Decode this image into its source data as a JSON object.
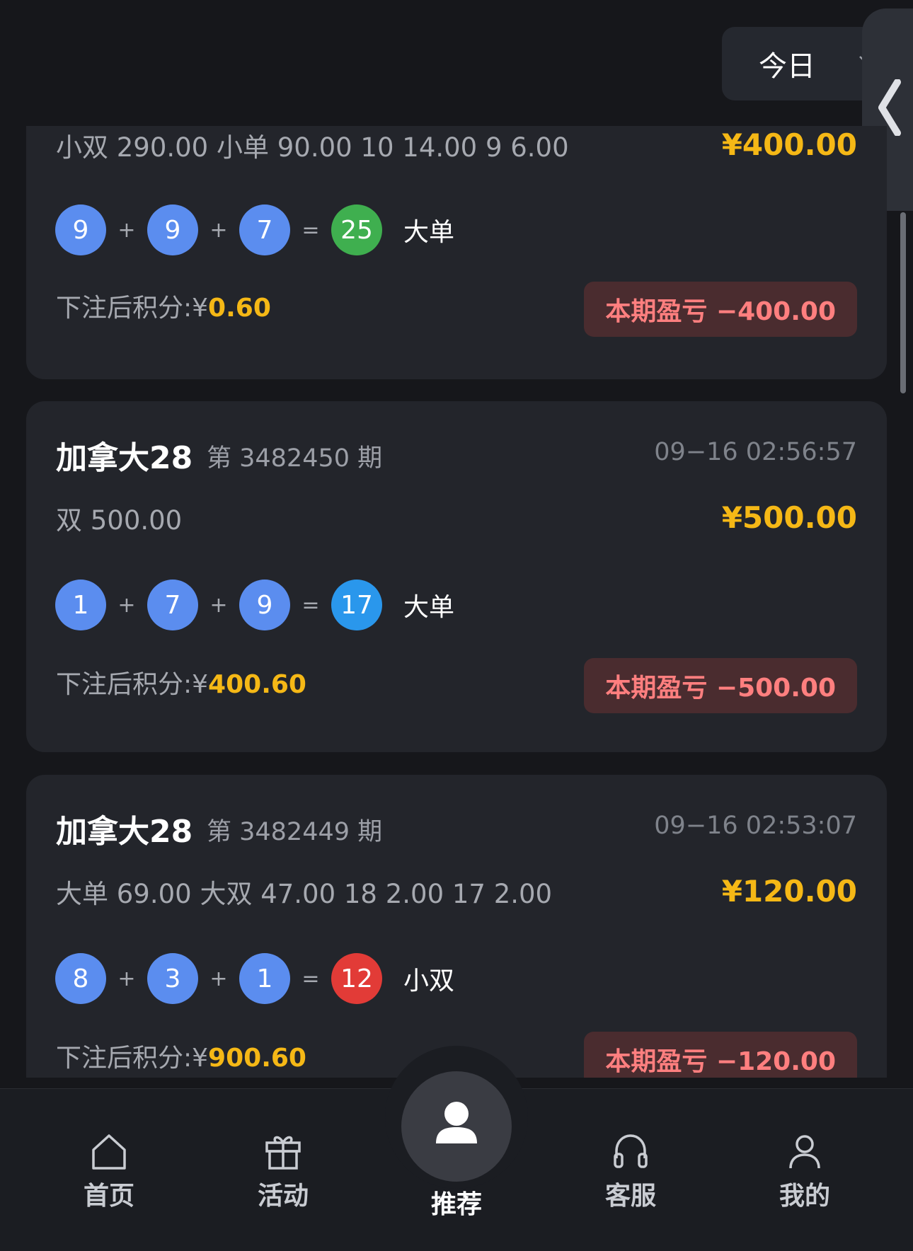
{
  "header": {
    "filter_label": "今日",
    "filter_icon": "chevron-down-icon",
    "side_handle_icon": "chevron-left-icon"
  },
  "colors": {
    "accent": "#f5b816",
    "ball_default": "#5b8def",
    "sum_green": "#3faf4f",
    "sum_blue": "#2a97ec",
    "sum_red": "#e23b37",
    "loss_text": "#ff7f7f",
    "loss_bg": "#4a2c2f"
  },
  "records": [
    {
      "title": "",
      "issue": "",
      "time": "",
      "bets": "小双 290.00 小单 90.00 10 14.00 9 6.00",
      "amount": "¥400.00",
      "balls": [
        "9",
        "9",
        "7"
      ],
      "plus": "+",
      "equals": "=",
      "sum": "25",
      "sum_color": "green",
      "result": "大单",
      "points_label": "下注后积分:¥",
      "points_value": "0.60",
      "pnl": "本期盈亏 −400.00"
    },
    {
      "title": "加拿大28",
      "issue": "第 3482450 期",
      "time": "09−16 02:56:57",
      "bets": "双 500.00",
      "amount": "¥500.00",
      "balls": [
        "1",
        "7",
        "9"
      ],
      "plus": "+",
      "equals": "=",
      "sum": "17",
      "sum_color": "blue",
      "result": "大单",
      "points_label": "下注后积分:¥",
      "points_value": "400.60",
      "pnl": "本期盈亏 −500.00"
    },
    {
      "title": "加拿大28",
      "issue": "第 3482449 期",
      "time": "09−16 02:53:07",
      "bets": "大单 69.00 大双 47.00 18 2.00 17 2.00",
      "amount": "¥120.00",
      "balls": [
        "8",
        "3",
        "1"
      ],
      "plus": "+",
      "equals": "=",
      "sum": "12",
      "sum_color": "red",
      "result": "小双",
      "points_label": "下注后积分:¥",
      "points_value": "900.60",
      "pnl": "本期盈亏 −120.00"
    }
  ],
  "tabbar": {
    "items": [
      {
        "label": "首页",
        "icon": "home-icon"
      },
      {
        "label": "活动",
        "icon": "gift-icon"
      },
      {
        "label": "推荐",
        "icon": "user-avatar-icon"
      },
      {
        "label": "客服",
        "icon": "headset-icon"
      },
      {
        "label": "我的",
        "icon": "profile-icon"
      }
    ]
  }
}
